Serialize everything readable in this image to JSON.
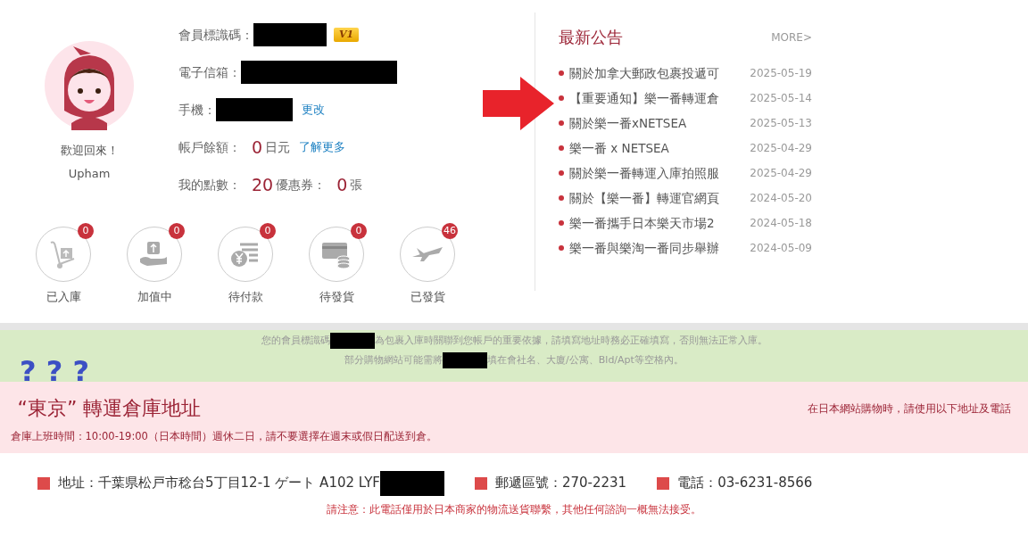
{
  "profile": {
    "welcome": "歡迎回來！",
    "username": "Upham"
  },
  "account": {
    "member_id_label": "會員標識碼：",
    "level_badge": "V1",
    "email_label": "電子信箱：",
    "phone_label": "手機：",
    "phone_link": "更改",
    "balance_label": "帳戶餘額：",
    "balance_value": "0",
    "balance_unit": "日元",
    "balance_link": "了解更多",
    "points_label": "我的點數：",
    "points_value": "20",
    "coupon_label": "優惠券：",
    "coupon_value": "0",
    "coupon_unit": "張"
  },
  "statuses": [
    {
      "kind": "cart",
      "label": "已入庫",
      "count": "0"
    },
    {
      "kind": "hand",
      "label": "加值中",
      "count": "0"
    },
    {
      "kind": "yen",
      "label": "待付款",
      "count": "0"
    },
    {
      "kind": "card",
      "label": "待發貨",
      "count": "0"
    },
    {
      "kind": "plane",
      "label": "已發貨",
      "count": "46"
    }
  ],
  "announcements": {
    "title": "最新公告",
    "more": "MORE>",
    "items": [
      {
        "title": "關於加拿大郵政包裹投遞可",
        "date": "2025-05-19"
      },
      {
        "title": "【重要通知】樂一番轉運倉",
        "date": "2025-05-14"
      },
      {
        "title": "關於樂一番xNETSEA",
        "date": "2025-05-13"
      },
      {
        "title": "樂一番 x NETSEA",
        "date": "2025-04-29"
      },
      {
        "title": "關於樂一番轉運入庫拍照服",
        "date": "2025-04-29"
      },
      {
        "title": "關於【樂一番】轉運官網頁",
        "date": "2024-05-20"
      },
      {
        "title": "樂一番攜手日本樂天市場2",
        "date": "2024-05-18"
      },
      {
        "title": "樂一番與樂淘一番同步舉辦",
        "date": "2024-05-09"
      }
    ]
  },
  "notice": {
    "line_1_before": "您的會員標識碼",
    "line_1_after": "為包裹入庫時關聯到您帳戶的重要依據，請填寫地址時務必正確填寫，否則無法正常入庫。",
    "line_2_before": "部分購物網站可能需將",
    "line_2_after": "填在會社名、大廈/公寓、Bld/Apt等空格內。",
    "annotation": "? ? ?"
  },
  "warehouse": {
    "title": "“東京” 轉運倉庫地址",
    "hint": "在日本網站購物時，請使用以下地址及電話",
    "hours": "倉庫上班時間：10:00-19:00（日本時間）週休二日，請不要選擇在週末或假日配送到倉。"
  },
  "address": [
    {
      "text": "地址：千葉県松戸市稔台5丁目12-1 ゲート A102 LYF",
      "redacted": true
    },
    {
      "text": "郵遞區號：270-2231",
      "redacted": false
    },
    {
      "text": "電話：03-6231-8566",
      "redacted": false
    }
  ],
  "note": "請注意：此電話僅用於日本商家的物流送貨聯繫，其他任何諮詢一概無法接受。"
}
